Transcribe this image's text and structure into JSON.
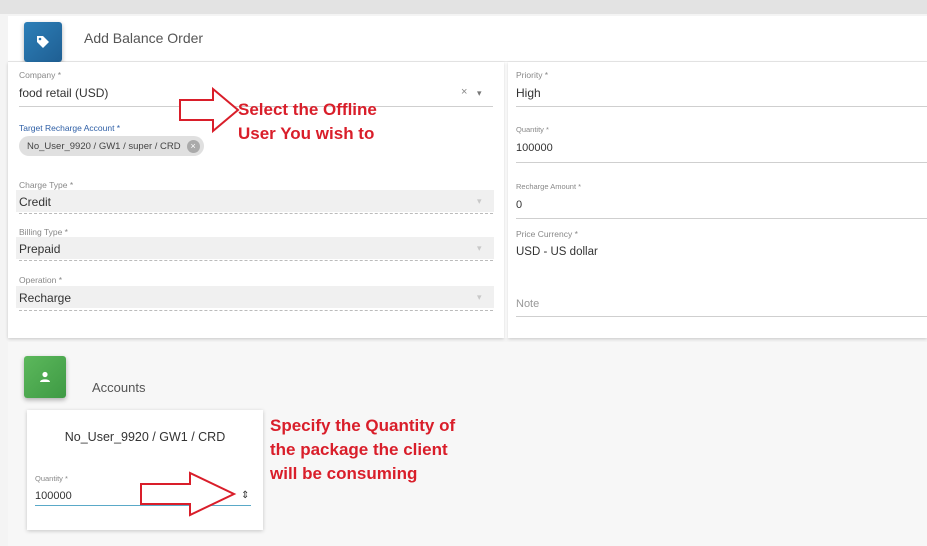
{
  "header": {
    "title": "Add Balance Order"
  },
  "left_form": {
    "company": {
      "label": "Company *",
      "value": "food retail (USD)",
      "clear_icon": "×",
      "caret_icon": "▾"
    },
    "target_account": {
      "label": "Target Recharge Account *",
      "chip_text": "No_User_9920 / GW1 / super / CRD",
      "chip_close": "×"
    },
    "charge_type": {
      "label": "Charge Type *",
      "value": "Credit"
    },
    "billing_type": {
      "label": "Billing Type *",
      "value": "Prepaid"
    },
    "operation": {
      "label": "Operation *",
      "value": "Recharge"
    },
    "caret_icon": "▾"
  },
  "right_form": {
    "priority": {
      "label": "Priority *",
      "value": "High"
    },
    "quantity": {
      "label": "Quantity *",
      "value": "100000"
    },
    "recharge_amount": {
      "label": "Recharge Amount *",
      "value": "0"
    },
    "price_currency": {
      "label": "Price Currency *",
      "value": "USD - US dollar"
    },
    "note": {
      "placeholder": "Note"
    }
  },
  "accounts": {
    "title": "Accounts",
    "account_name": "No_User_9920 / GW1 / CRD",
    "quantity_label": "Quantity *",
    "quantity_value": "100000",
    "spinner_icon": "⇕"
  },
  "annotations": {
    "select_line1": "Select the Offline",
    "select_line2": "User You wish to",
    "specify_line1": "Specify the Quantity of",
    "specify_line2": "the package the client",
    "specify_line3": "will be consuming"
  },
  "colors": {
    "annotation": "#d91e2a",
    "tag_icon_bg": "#2d7fb8",
    "user_icon_bg": "#5cb85c",
    "chip_bg": "#e0e0e0",
    "link_label": "#2e5fa6"
  },
  "icons": {
    "header": "tag-icon",
    "accounts": "user-icon",
    "arrow": "outline-right-arrow"
  }
}
